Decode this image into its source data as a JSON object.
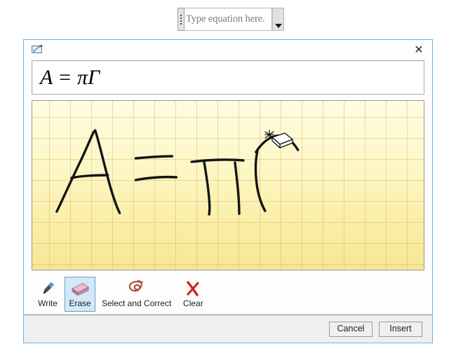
{
  "document": {
    "content_control": {
      "handle_icon": "drag-handle-icon",
      "placeholder": "Type equation here.",
      "dropdown_icon": "chevron-down-icon"
    }
  },
  "dialog": {
    "app_icon": "ink-pad-icon",
    "close_label": "✕",
    "preview": {
      "equation": "A = πΓ"
    },
    "canvas": {
      "name": "ink-writing-surface",
      "background_top_color": "#FFFCE2",
      "background_bottom_color": "#F6E695",
      "gridline_color": "#D6A860",
      "ink_color": "#141414",
      "cursor": "eraser-cursor"
    },
    "tools": [
      {
        "id": "write",
        "label": "Write",
        "icon": "pen-icon",
        "selected": false
      },
      {
        "id": "erase",
        "label": "Erase",
        "icon": "eraser-icon",
        "selected": true
      },
      {
        "id": "select-and-correct",
        "label": "Select and Correct",
        "icon": "lasso-icon",
        "selected": false
      },
      {
        "id": "clear",
        "label": "Clear",
        "icon": "red-x-icon",
        "selected": false
      }
    ],
    "footer": {
      "cancel_label": "Cancel",
      "insert_label": "Insert"
    },
    "colors": {
      "border": "#6CB3E8",
      "selected_tool_bg": "#D3E9F7",
      "selected_tool_border": "#5E9FD0",
      "footer_bg": "#EFEFEF"
    }
  }
}
